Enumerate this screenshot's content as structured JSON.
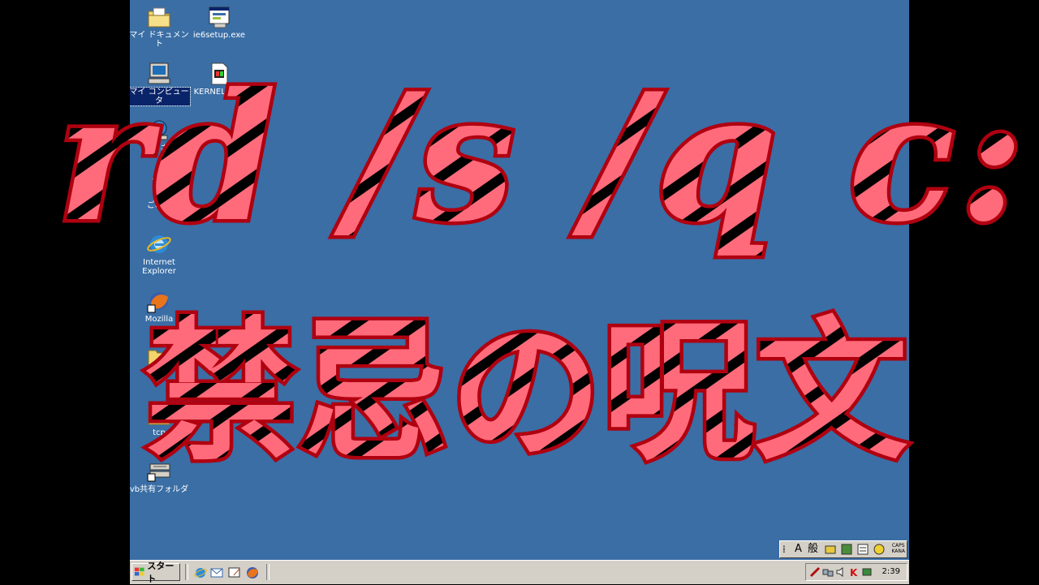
{
  "desktop": {
    "background": "#3a6ea5",
    "icons": [
      {
        "label": "マイ ドキュメント",
        "icon": "my-documents-icon"
      },
      {
        "label": "ie6setup.exe",
        "icon": "setup-exe-icon"
      },
      {
        "label": "マイ コンピュータ",
        "icon": "my-computer-icon",
        "selected": true
      },
      {
        "label": "KERNEL32.D",
        "icon": "dll-file-icon"
      },
      {
        "label": "マイ ネッ",
        "icon": "my-network-icon"
      },
      {
        "label": "ごみ箱",
        "icon": "recycle-bin-icon"
      },
      {
        "label": "Internet Explorer",
        "icon": "internet-explorer-icon"
      },
      {
        "label": "Mozilla",
        "icon": "firefox-icon"
      },
      {
        "label": "Proc",
        "icon": "folder-icon"
      },
      {
        "label": "tcp",
        "icon": "folder-icon"
      },
      {
        "label": "vb共有フォルダ",
        "icon": "shared-folder-shortcut-icon"
      }
    ]
  },
  "overlay": {
    "line1": "rd /s /q c:\\",
    "line2": "禁忌の呪文",
    "fill_color": "#ff6b7a",
    "outline_color": "#b00010",
    "stripe_color": "#000000"
  },
  "taskbar": {
    "start_label": "スタート",
    "quick_launch": [
      "internet-explorer-icon",
      "outlook-express-icon",
      "show-desktop-icon",
      "firefox-icon"
    ],
    "clock": "2:39"
  },
  "ime": {
    "mode": "A",
    "kanji": "般",
    "caps": "CAPS",
    "kana": "KANA"
  }
}
